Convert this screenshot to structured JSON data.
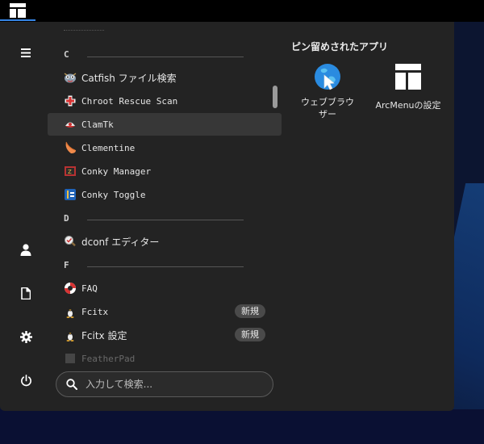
{
  "panel": {
    "menu_button_icon": "layout-icon"
  },
  "sidebar": {
    "items": [
      {
        "name": "menu-hamburger",
        "icon": "hamburger-icon"
      },
      {
        "name": "user",
        "icon": "user-icon"
      },
      {
        "name": "documents",
        "icon": "document-icon"
      },
      {
        "name": "settings",
        "icon": "gear-icon"
      },
      {
        "name": "power",
        "icon": "power-icon"
      }
    ]
  },
  "apps": {
    "sections": [
      {
        "letter": "C"
      },
      {
        "letter": "D"
      },
      {
        "letter": "F"
      }
    ],
    "items": [
      {
        "label": "Catfish ファイル検索",
        "icon": "catfish-icon"
      },
      {
        "label": "Chroot Rescue Scan",
        "icon": "medical-cross-icon"
      },
      {
        "label": "ClamTk",
        "icon": "clamtk-icon",
        "selected": true
      },
      {
        "label": "Clementine",
        "icon": "clementine-icon"
      },
      {
        "label": "Conky Manager",
        "icon": "conky-manager-icon"
      },
      {
        "label": "Conky Toggle",
        "icon": "conky-toggle-icon"
      },
      {
        "label": "dconf エディター",
        "icon": "dconf-icon"
      },
      {
        "label": "FAQ",
        "icon": "lifebuoy-icon"
      },
      {
        "label": "Fcitx",
        "icon": "penguin-icon",
        "badge": "新規"
      },
      {
        "label": "Fcitx 設定",
        "icon": "penguin-icon",
        "badge": "新規"
      },
      {
        "label": "FeatherPad",
        "icon": "featherpad-icon"
      }
    ]
  },
  "search": {
    "placeholder": "入力して検索..."
  },
  "pinned": {
    "title": "ピン留めされたアプリ",
    "items": [
      {
        "label_line1": "ウェブブラウ",
        "label_line2": "ザー",
        "icon": "web-browser-icon"
      },
      {
        "label_line1": "ArcMenuの設定",
        "icon": "layout-icon"
      }
    ]
  },
  "colors": {
    "menu_bg": "#232323",
    "selected_row": "#373737",
    "accent": "#3584e4",
    "badge_bg": "#4a4a4a"
  }
}
